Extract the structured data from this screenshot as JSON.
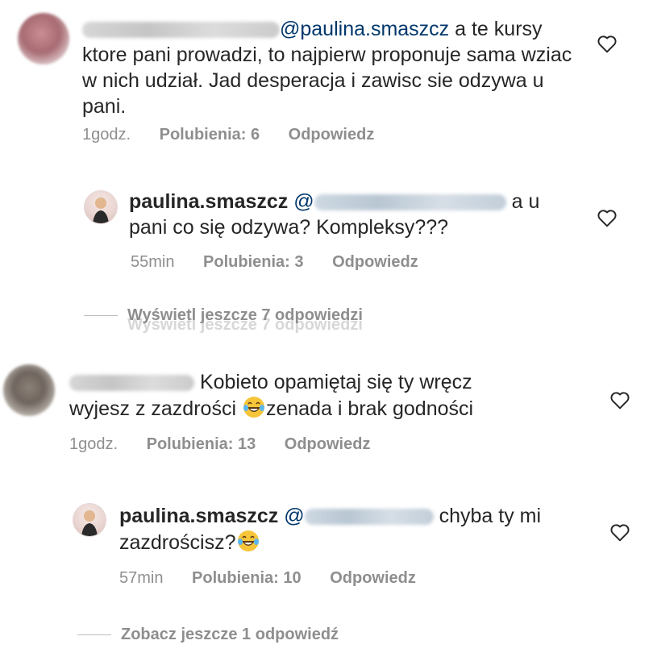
{
  "comments": [
    {
      "text": "a te kursy ktore pani prowadzi, to najpierw proponuje sama wziac w nich udział. Jad desperacja i zawisc sie odzywa u pani.",
      "mention": "@paulina.smaszcz",
      "time": "1godz.",
      "likes": "Polubienia: 6",
      "reply": "Odpowiedz"
    },
    {
      "username": "paulina.smaszcz",
      "mention_prefix": "@",
      "text": "a u pani co się odzywa? Kompleksy???",
      "time": "55min",
      "likes": "Polubienia: 3",
      "reply": "Odpowiedz"
    },
    {
      "text_a": "Kobieto opamiętaj się ty wręcz",
      "text_b": "wyjesz z zazdrości",
      "text_c": "zenada i brak godności",
      "time": "1godz.",
      "likes": "Polubienia: 13",
      "reply": "Odpowiedz"
    },
    {
      "username": "paulina.smaszcz",
      "mention_prefix": "@",
      "text_a": "chyba ty mi",
      "text_b": "zazdrościsz?",
      "time": "57min",
      "likes": "Polubienia: 10",
      "reply": "Odpowiedz"
    }
  ],
  "view_more_1": "Wyświetl jeszcze 7 odpowiedzi",
  "view_more_2": "Zobacz jeszcze 1 odpowiedź",
  "icons": {
    "like": "heart-outline-icon",
    "emoji": "laughing-tears-emoji"
  }
}
